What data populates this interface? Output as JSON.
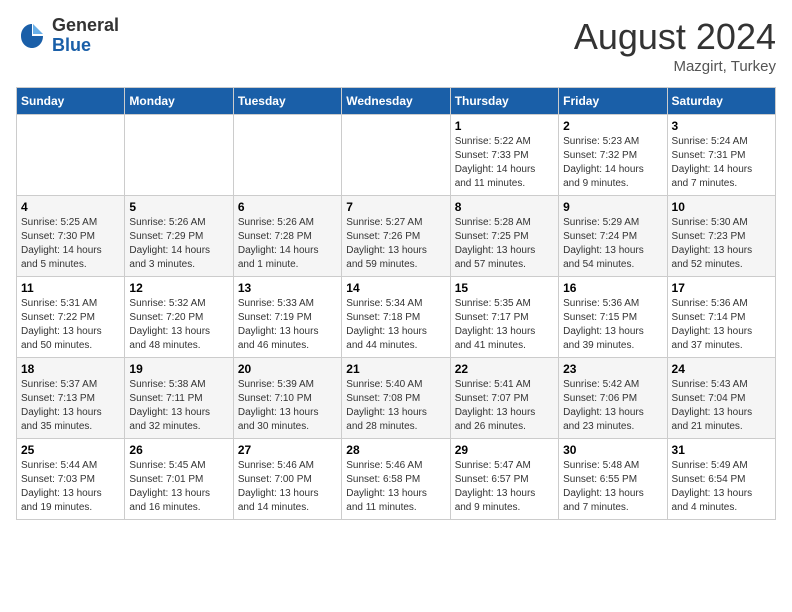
{
  "header": {
    "logo_general": "General",
    "logo_blue": "Blue",
    "month_year": "August 2024",
    "location": "Mazgirt, Turkey"
  },
  "weekdays": [
    "Sunday",
    "Monday",
    "Tuesday",
    "Wednesday",
    "Thursday",
    "Friday",
    "Saturday"
  ],
  "weeks": [
    [
      {
        "day": "",
        "info": ""
      },
      {
        "day": "",
        "info": ""
      },
      {
        "day": "",
        "info": ""
      },
      {
        "day": "",
        "info": ""
      },
      {
        "day": "1",
        "info": "Sunrise: 5:22 AM\nSunset: 7:33 PM\nDaylight: 14 hours\nand 11 minutes."
      },
      {
        "day": "2",
        "info": "Sunrise: 5:23 AM\nSunset: 7:32 PM\nDaylight: 14 hours\nand 9 minutes."
      },
      {
        "day": "3",
        "info": "Sunrise: 5:24 AM\nSunset: 7:31 PM\nDaylight: 14 hours\nand 7 minutes."
      }
    ],
    [
      {
        "day": "4",
        "info": "Sunrise: 5:25 AM\nSunset: 7:30 PM\nDaylight: 14 hours\nand 5 minutes."
      },
      {
        "day": "5",
        "info": "Sunrise: 5:26 AM\nSunset: 7:29 PM\nDaylight: 14 hours\nand 3 minutes."
      },
      {
        "day": "6",
        "info": "Sunrise: 5:26 AM\nSunset: 7:28 PM\nDaylight: 14 hours\nand 1 minute."
      },
      {
        "day": "7",
        "info": "Sunrise: 5:27 AM\nSunset: 7:26 PM\nDaylight: 13 hours\nand 59 minutes."
      },
      {
        "day": "8",
        "info": "Sunrise: 5:28 AM\nSunset: 7:25 PM\nDaylight: 13 hours\nand 57 minutes."
      },
      {
        "day": "9",
        "info": "Sunrise: 5:29 AM\nSunset: 7:24 PM\nDaylight: 13 hours\nand 54 minutes."
      },
      {
        "day": "10",
        "info": "Sunrise: 5:30 AM\nSunset: 7:23 PM\nDaylight: 13 hours\nand 52 minutes."
      }
    ],
    [
      {
        "day": "11",
        "info": "Sunrise: 5:31 AM\nSunset: 7:22 PM\nDaylight: 13 hours\nand 50 minutes."
      },
      {
        "day": "12",
        "info": "Sunrise: 5:32 AM\nSunset: 7:20 PM\nDaylight: 13 hours\nand 48 minutes."
      },
      {
        "day": "13",
        "info": "Sunrise: 5:33 AM\nSunset: 7:19 PM\nDaylight: 13 hours\nand 46 minutes."
      },
      {
        "day": "14",
        "info": "Sunrise: 5:34 AM\nSunset: 7:18 PM\nDaylight: 13 hours\nand 44 minutes."
      },
      {
        "day": "15",
        "info": "Sunrise: 5:35 AM\nSunset: 7:17 PM\nDaylight: 13 hours\nand 41 minutes."
      },
      {
        "day": "16",
        "info": "Sunrise: 5:36 AM\nSunset: 7:15 PM\nDaylight: 13 hours\nand 39 minutes."
      },
      {
        "day": "17",
        "info": "Sunrise: 5:36 AM\nSunset: 7:14 PM\nDaylight: 13 hours\nand 37 minutes."
      }
    ],
    [
      {
        "day": "18",
        "info": "Sunrise: 5:37 AM\nSunset: 7:13 PM\nDaylight: 13 hours\nand 35 minutes."
      },
      {
        "day": "19",
        "info": "Sunrise: 5:38 AM\nSunset: 7:11 PM\nDaylight: 13 hours\nand 32 minutes."
      },
      {
        "day": "20",
        "info": "Sunrise: 5:39 AM\nSunset: 7:10 PM\nDaylight: 13 hours\nand 30 minutes."
      },
      {
        "day": "21",
        "info": "Sunrise: 5:40 AM\nSunset: 7:08 PM\nDaylight: 13 hours\nand 28 minutes."
      },
      {
        "day": "22",
        "info": "Sunrise: 5:41 AM\nSunset: 7:07 PM\nDaylight: 13 hours\nand 26 minutes."
      },
      {
        "day": "23",
        "info": "Sunrise: 5:42 AM\nSunset: 7:06 PM\nDaylight: 13 hours\nand 23 minutes."
      },
      {
        "day": "24",
        "info": "Sunrise: 5:43 AM\nSunset: 7:04 PM\nDaylight: 13 hours\nand 21 minutes."
      }
    ],
    [
      {
        "day": "25",
        "info": "Sunrise: 5:44 AM\nSunset: 7:03 PM\nDaylight: 13 hours\nand 19 minutes."
      },
      {
        "day": "26",
        "info": "Sunrise: 5:45 AM\nSunset: 7:01 PM\nDaylight: 13 hours\nand 16 minutes."
      },
      {
        "day": "27",
        "info": "Sunrise: 5:46 AM\nSunset: 7:00 PM\nDaylight: 13 hours\nand 14 minutes."
      },
      {
        "day": "28",
        "info": "Sunrise: 5:46 AM\nSunset: 6:58 PM\nDaylight: 13 hours\nand 11 minutes."
      },
      {
        "day": "29",
        "info": "Sunrise: 5:47 AM\nSunset: 6:57 PM\nDaylight: 13 hours\nand 9 minutes."
      },
      {
        "day": "30",
        "info": "Sunrise: 5:48 AM\nSunset: 6:55 PM\nDaylight: 13 hours\nand 7 minutes."
      },
      {
        "day": "31",
        "info": "Sunrise: 5:49 AM\nSunset: 6:54 PM\nDaylight: 13 hours\nand 4 minutes."
      }
    ]
  ]
}
